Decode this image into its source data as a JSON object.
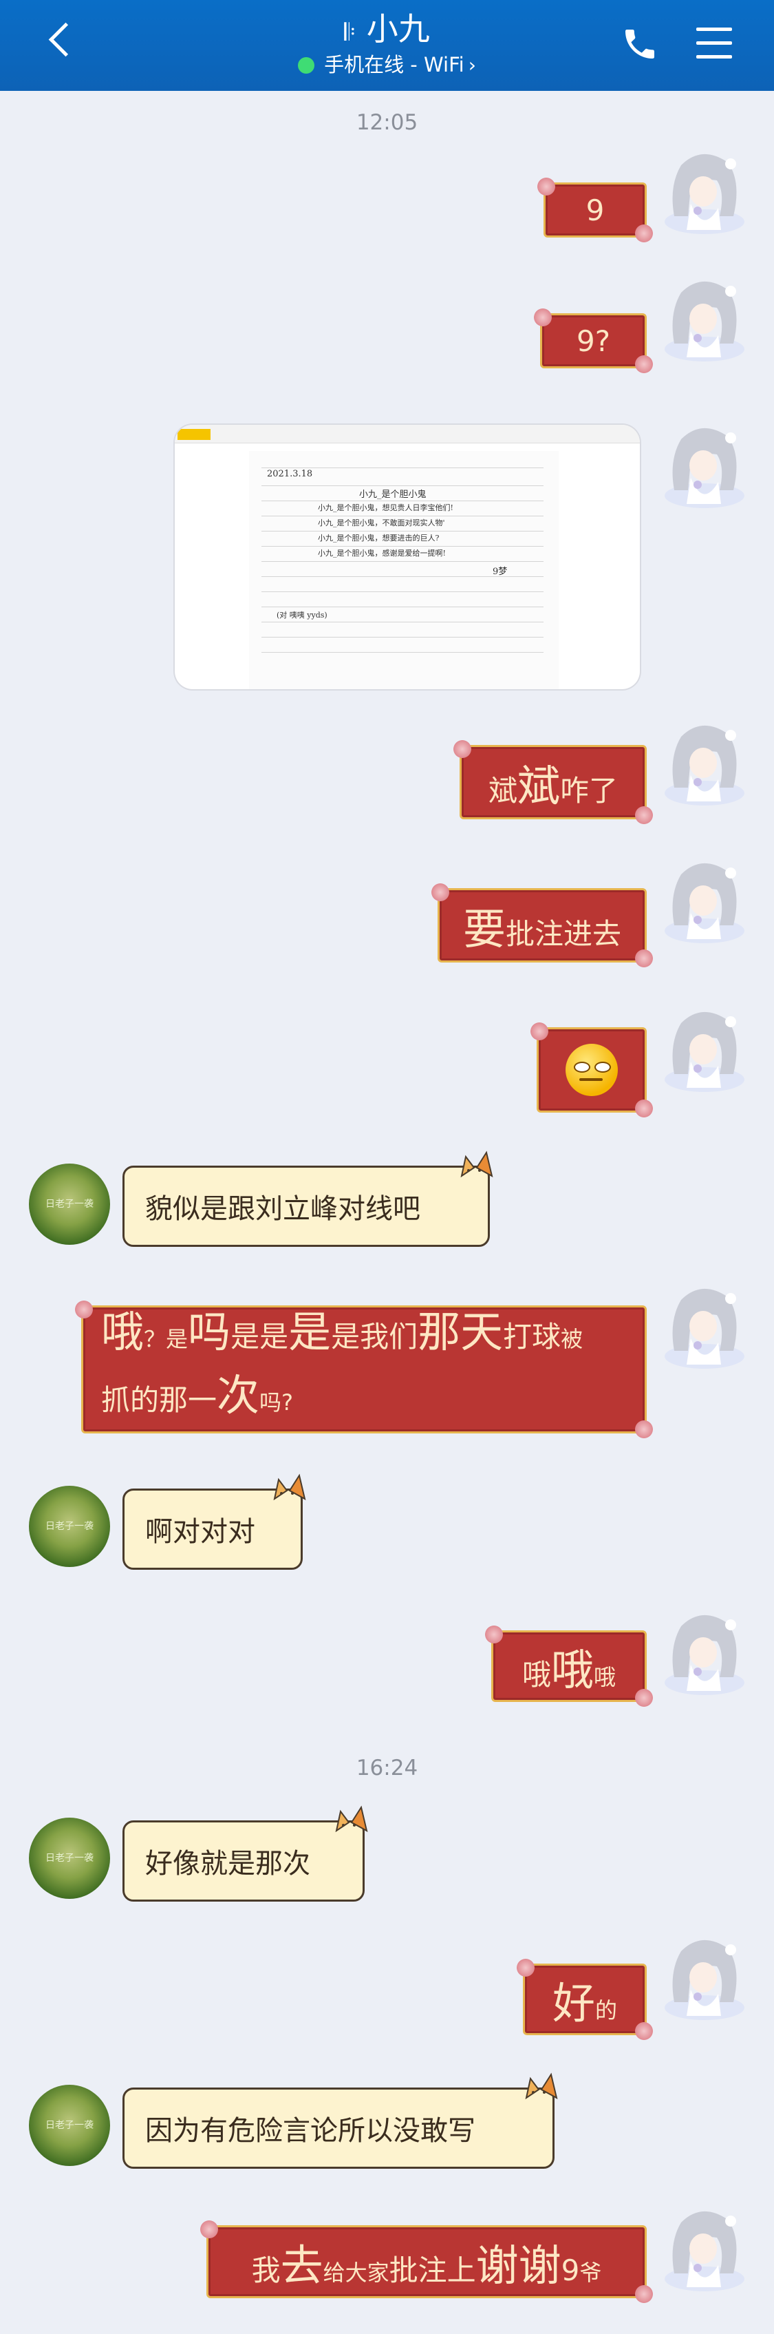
{
  "header": {
    "title": "小九",
    "ear_icon": "𝄆",
    "status": "手机在线 - WiFi",
    "status_color": "#3fdc74",
    "bar_color": "#0d62b6"
  },
  "times": [
    "12:05",
    "16:24"
  ],
  "image_message": {
    "doc_date": "2021.3.18",
    "doc_signature": "小九_是个胆小鬼",
    "doc_lines": [
      "小九_是个胆小鬼，想见贵人日李宝他们!",
      "小九_是个胆小鬼，不敢面对现实人物'",
      "小九_是个胆小鬼，想要进击的巨人?",
      "小九_是个胆小鬼，感谢是爱给一提啊!"
    ],
    "doc_sign": "9梦",
    "doc_footer": "(对 咦咦 yyds)"
  },
  "messages": [
    {
      "side": "right",
      "parts": [
        {
          "t": "9",
          "s": "44"
        }
      ]
    },
    {
      "side": "right",
      "parts": [
        {
          "t": "9?",
          "s": "44"
        }
      ]
    },
    {
      "side": "right",
      "parts": [
        {
          "t": "斌",
          "s": "44"
        },
        {
          "t": "斌",
          "s": "60"
        },
        {
          "t": "咋了",
          "s": "44"
        }
      ]
    },
    {
      "side": "right",
      "parts": [
        {
          "t": "要",
          "s": "60"
        },
        {
          "t": "批注进去",
          "s": "44"
        }
      ]
    },
    {
      "side": "right",
      "emoji": "smirk-emoji"
    },
    {
      "side": "left",
      "text": "貌似是跟刘立峰对线吧"
    },
    {
      "side": "right",
      "parts": [
        {
          "t": "哦",
          "s": "60"
        },
        {
          "t": "？",
          "s": "32"
        },
        {
          "t": "是",
          "s": "32"
        },
        {
          "t": "吗",
          "s": "60"
        },
        {
          "t": "是是",
          "s": "44"
        },
        {
          "t": "是",
          "s": "60"
        },
        {
          "t": "是我们",
          "s": "44"
        },
        {
          "t": "那天",
          "s": "60"
        },
        {
          "t": "打球",
          "s": "44"
        },
        {
          "t": "被",
          "s": "32"
        }
      ],
      "parts2": [
        {
          "t": "抓的那一",
          "s": "44"
        },
        {
          "t": "次",
          "s": "60"
        },
        {
          "t": "吗?",
          "s": "32"
        }
      ]
    },
    {
      "side": "left",
      "text": "啊对对对"
    },
    {
      "side": "right",
      "parts": [
        {
          "t": "哦",
          "s": "44"
        },
        {
          "t": "哦",
          "s": "60"
        },
        {
          "t": "哦",
          "s": "32"
        }
      ]
    },
    {
      "side": "left",
      "text": "好像就是那次"
    },
    {
      "side": "right",
      "parts": [
        {
          "t": "好",
          "s": "60"
        },
        {
          "t": "的",
          "s": "32"
        }
      ]
    },
    {
      "side": "left",
      "text": "因为有危险言论所以没敢写"
    },
    {
      "side": "right",
      "parts": [
        {
          "t": "我",
          "s": "44"
        },
        {
          "t": "去",
          "s": "60"
        },
        {
          "t": "给大家",
          "s": "32"
        },
        {
          "t": "批注上",
          "s": "44"
        },
        {
          "t": "谢谢",
          "s": "60"
        },
        {
          "t": "9",
          "s": "44"
        },
        {
          "t": "爷",
          "s": "32"
        }
      ]
    }
  ],
  "other_avatar_text": "日老子一袭",
  "colors": {
    "bubble_red": "#b93633",
    "bubble_gold": "#e7b54e",
    "bubble_cream": "#fdf3cf",
    "bg": "#eceff6"
  }
}
